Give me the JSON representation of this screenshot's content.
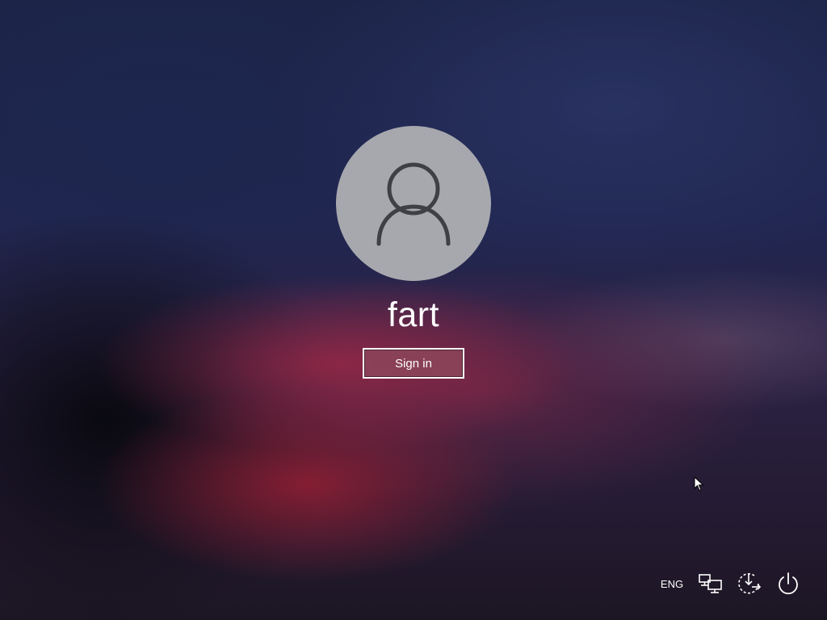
{
  "user": {
    "name": "fart",
    "avatar_icon": "user-silhouette-icon"
  },
  "signin_button": {
    "label": "Sign in"
  },
  "tray": {
    "language": "ENG",
    "network_icon": "network-icon",
    "accessibility_icon": "ease-of-access-icon",
    "power_icon": "power-icon"
  },
  "colors": {
    "avatar_bg": "#a7a8ae",
    "avatar_glyph": "#3f4046",
    "button_fill": "#8c465a",
    "button_border": "#ffffff"
  }
}
